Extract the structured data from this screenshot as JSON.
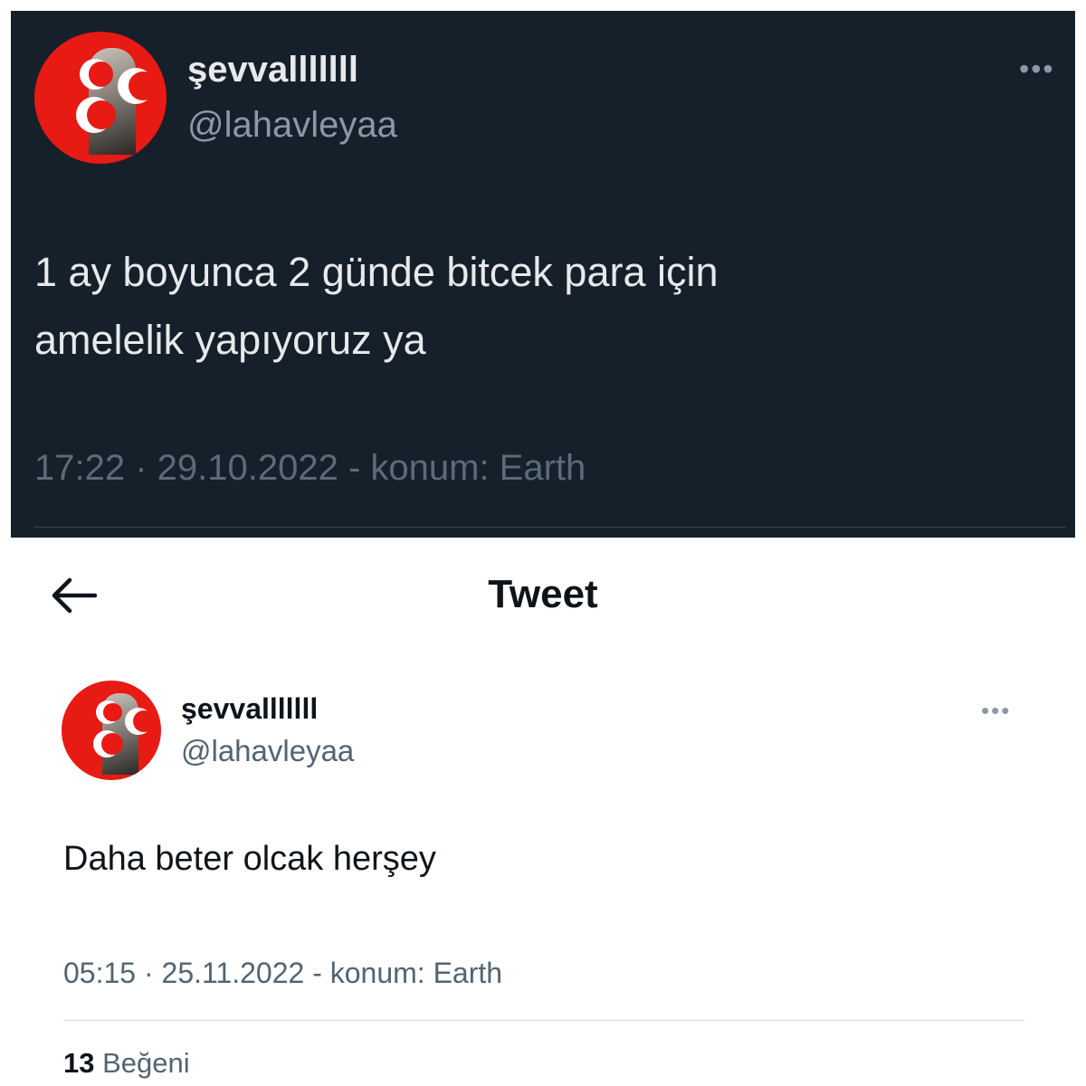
{
  "dark_tweet": {
    "display_name": "şevvalllllll",
    "handle": "@lahavleyaa",
    "more_icon": "more-horizontal-icon",
    "text_line1": "1 ay  boyunca 2 günde bitcek para için",
    "text_line2": "amelelik yapıyoruz ya",
    "meta": "17:22 · 29.10.2022 - konum: Earth"
  },
  "header": {
    "back_icon": "arrow-left-icon",
    "title": "Tweet"
  },
  "light_tweet": {
    "display_name": "şevvalllllll",
    "handle": "@lahavleyaa",
    "more_icon": "more-horizontal-icon",
    "text": "Daha beter olcak herşey",
    "meta": "05:15 · 25.11.2022 - konum: Earth",
    "like_count": "13",
    "like_label": "Beğeni"
  },
  "colors": {
    "dark_bg": "#15202b",
    "avatar_red": "#e81a14",
    "muted_dark": "#8b98a5",
    "muted_light": "#536471"
  }
}
